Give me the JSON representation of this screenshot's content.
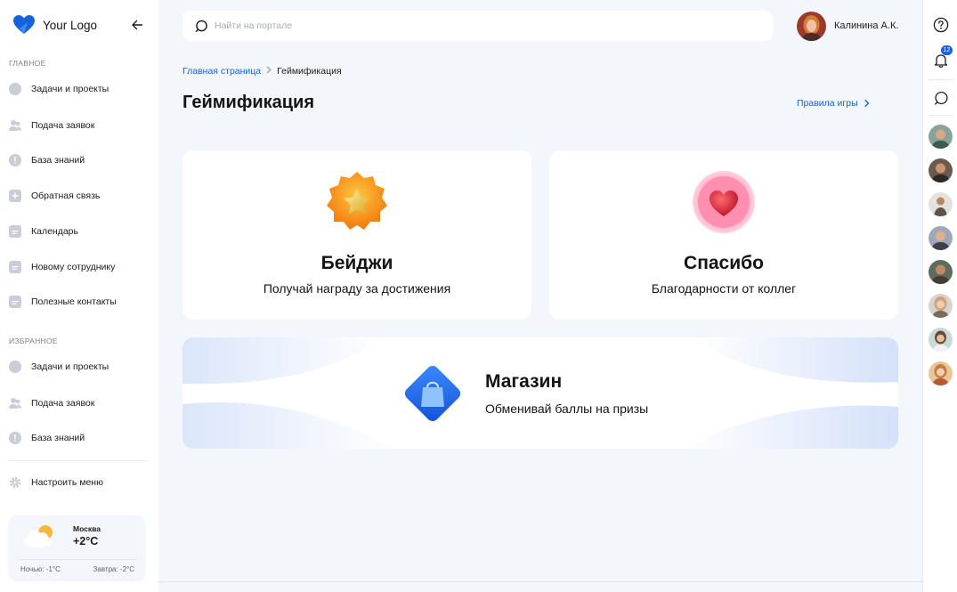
{
  "sidebar": {
    "logo_text": "Your Logo",
    "sections": {
      "main_label": "ГЛАВНОЕ",
      "favorites_label": "ИЗБРАННОЕ"
    },
    "main_items": [
      {
        "label": "Задачи и проекты",
        "icon": "rocket-icon"
      },
      {
        "label": "Подача заявок",
        "icon": "users-icon"
      },
      {
        "label": "База знаний",
        "icon": "info-icon"
      },
      {
        "label": "Обратная связь",
        "icon": "plus-square-icon"
      },
      {
        "label": "Календарь",
        "icon": "document-icon"
      },
      {
        "label": "Новому сотруднику",
        "icon": "document-icon"
      },
      {
        "label": "Полезные контакты",
        "icon": "document-icon"
      }
    ],
    "favorite_items": [
      {
        "label": "Задачи и проекты",
        "icon": "rocket-icon"
      },
      {
        "label": "Подача заявок",
        "icon": "users-icon"
      },
      {
        "label": "База знаний",
        "icon": "info-icon"
      }
    ],
    "settings_label": "Настроить меню",
    "weather": {
      "city": "Москва",
      "temp": "+2°C",
      "night": "Ночью: -1°C",
      "tomorrow": "Завтра: -2°C"
    }
  },
  "header": {
    "search_placeholder": "Найти на портале",
    "search_value": "",
    "user_name": "Калинина А.К."
  },
  "breadcrumb": {
    "home": "Главная страница",
    "current": "Геймификация"
  },
  "page": {
    "title": "Геймификация",
    "rules_link": "Правила игры"
  },
  "cards": {
    "badges": {
      "title": "Бейджи",
      "subtitle": "Получай награду за достижения"
    },
    "thanks": {
      "title": "Спасибо",
      "subtitle": "Благодарности от коллег"
    },
    "shop": {
      "title": "Магазин",
      "subtitle": "Обменивай баллы на призы"
    }
  },
  "rail": {
    "notifications_count": "12"
  },
  "colors": {
    "accent": "#1662d8",
    "background": "#f3f6fb",
    "badge_orange": "#f59a16",
    "heart_red": "#e0253f",
    "shop_blue": "#1f6cf0"
  }
}
